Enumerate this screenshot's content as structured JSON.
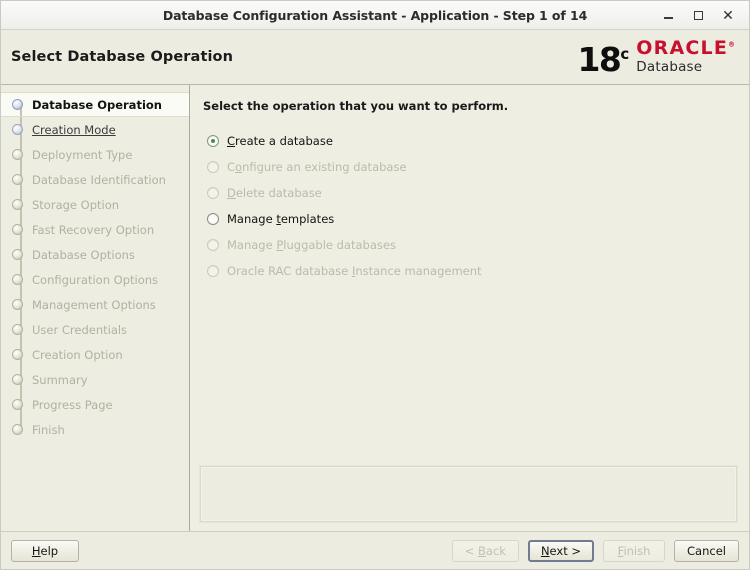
{
  "window": {
    "title": "Database Configuration Assistant - Application - Step 1 of 14",
    "controls": {
      "minimize": "minimize-icon",
      "maximize": "maximize-icon",
      "close": "close-icon"
    }
  },
  "header": {
    "page_title": "Select Database Operation",
    "brand": {
      "version": "18",
      "version_suffix": "c",
      "name": "ORACLE",
      "trademark": "®",
      "product": "Database",
      "oracle_red": "#c8102e"
    }
  },
  "sidebar": {
    "steps": [
      {
        "label": "Database Operation",
        "state": "active"
      },
      {
        "label": "Creation Mode",
        "state": "visited"
      },
      {
        "label": "Deployment Type",
        "state": "pending"
      },
      {
        "label": "Database Identification",
        "state": "pending"
      },
      {
        "label": "Storage Option",
        "state": "pending"
      },
      {
        "label": "Fast Recovery Option",
        "state": "pending"
      },
      {
        "label": "Database Options",
        "state": "pending"
      },
      {
        "label": "Configuration Options",
        "state": "pending"
      },
      {
        "label": "Management Options",
        "state": "pending"
      },
      {
        "label": "User Credentials",
        "state": "pending"
      },
      {
        "label": "Creation Option",
        "state": "pending"
      },
      {
        "label": "Summary",
        "state": "pending"
      },
      {
        "label": "Progress Page",
        "state": "pending"
      },
      {
        "label": "Finish",
        "state": "pending"
      }
    ]
  },
  "main": {
    "prompt": "Select the operation that you want to perform.",
    "options": [
      {
        "label": "Create a database",
        "mnemonic": "C",
        "pre": "",
        "post": "reate a database",
        "checked": true,
        "disabled": false
      },
      {
        "label": "Configure an existing database",
        "mnemonic": "o",
        "pre": "C",
        "post": "nfigure an existing database",
        "checked": false,
        "disabled": true
      },
      {
        "label": "Delete database",
        "mnemonic": "D",
        "pre": "",
        "post": "elete database",
        "checked": false,
        "disabled": true
      },
      {
        "label": "Manage templates",
        "mnemonic": "t",
        "pre": "Manage ",
        "post": "emplates",
        "checked": false,
        "disabled": false
      },
      {
        "label": "Manage Pluggable databases",
        "mnemonic": "P",
        "pre": "Manage ",
        "post": "luggable databases",
        "checked": false,
        "disabled": true
      },
      {
        "label": "Oracle RAC database Instance management",
        "mnemonic": "I",
        "pre": "Oracle RAC database ",
        "post": "nstance management",
        "checked": false,
        "disabled": true
      }
    ],
    "message_panel": ""
  },
  "footer": {
    "help": "Help",
    "back": "< Back",
    "next": "Next >",
    "finish": "Finish",
    "cancel": "Cancel"
  }
}
